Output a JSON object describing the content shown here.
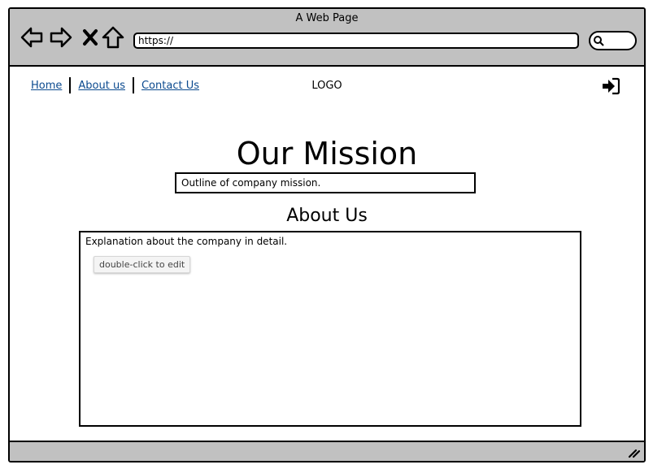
{
  "browser": {
    "title": "A Web Page",
    "url": "https://",
    "icons": [
      "back-arrow-icon",
      "forward-arrow-icon",
      "close-icon",
      "home-icon",
      "search-icon"
    ]
  },
  "nav": {
    "links": [
      "Home",
      "About us",
      "Contact Us"
    ],
    "logo": "LOGO",
    "login_icon": "sign-in-icon"
  },
  "mission": {
    "title": "Our Mission",
    "outline": "Outline of company mission."
  },
  "about": {
    "title": "About Us",
    "text": "Explanation about the company in detail.",
    "edit_hint": "double-click to edit"
  },
  "status_bar": {
    "icon": "resize-grip-icon"
  },
  "colors": {
    "chrome": "#c1c1c1",
    "link": "#0b4a8f",
    "border": "#000000"
  }
}
